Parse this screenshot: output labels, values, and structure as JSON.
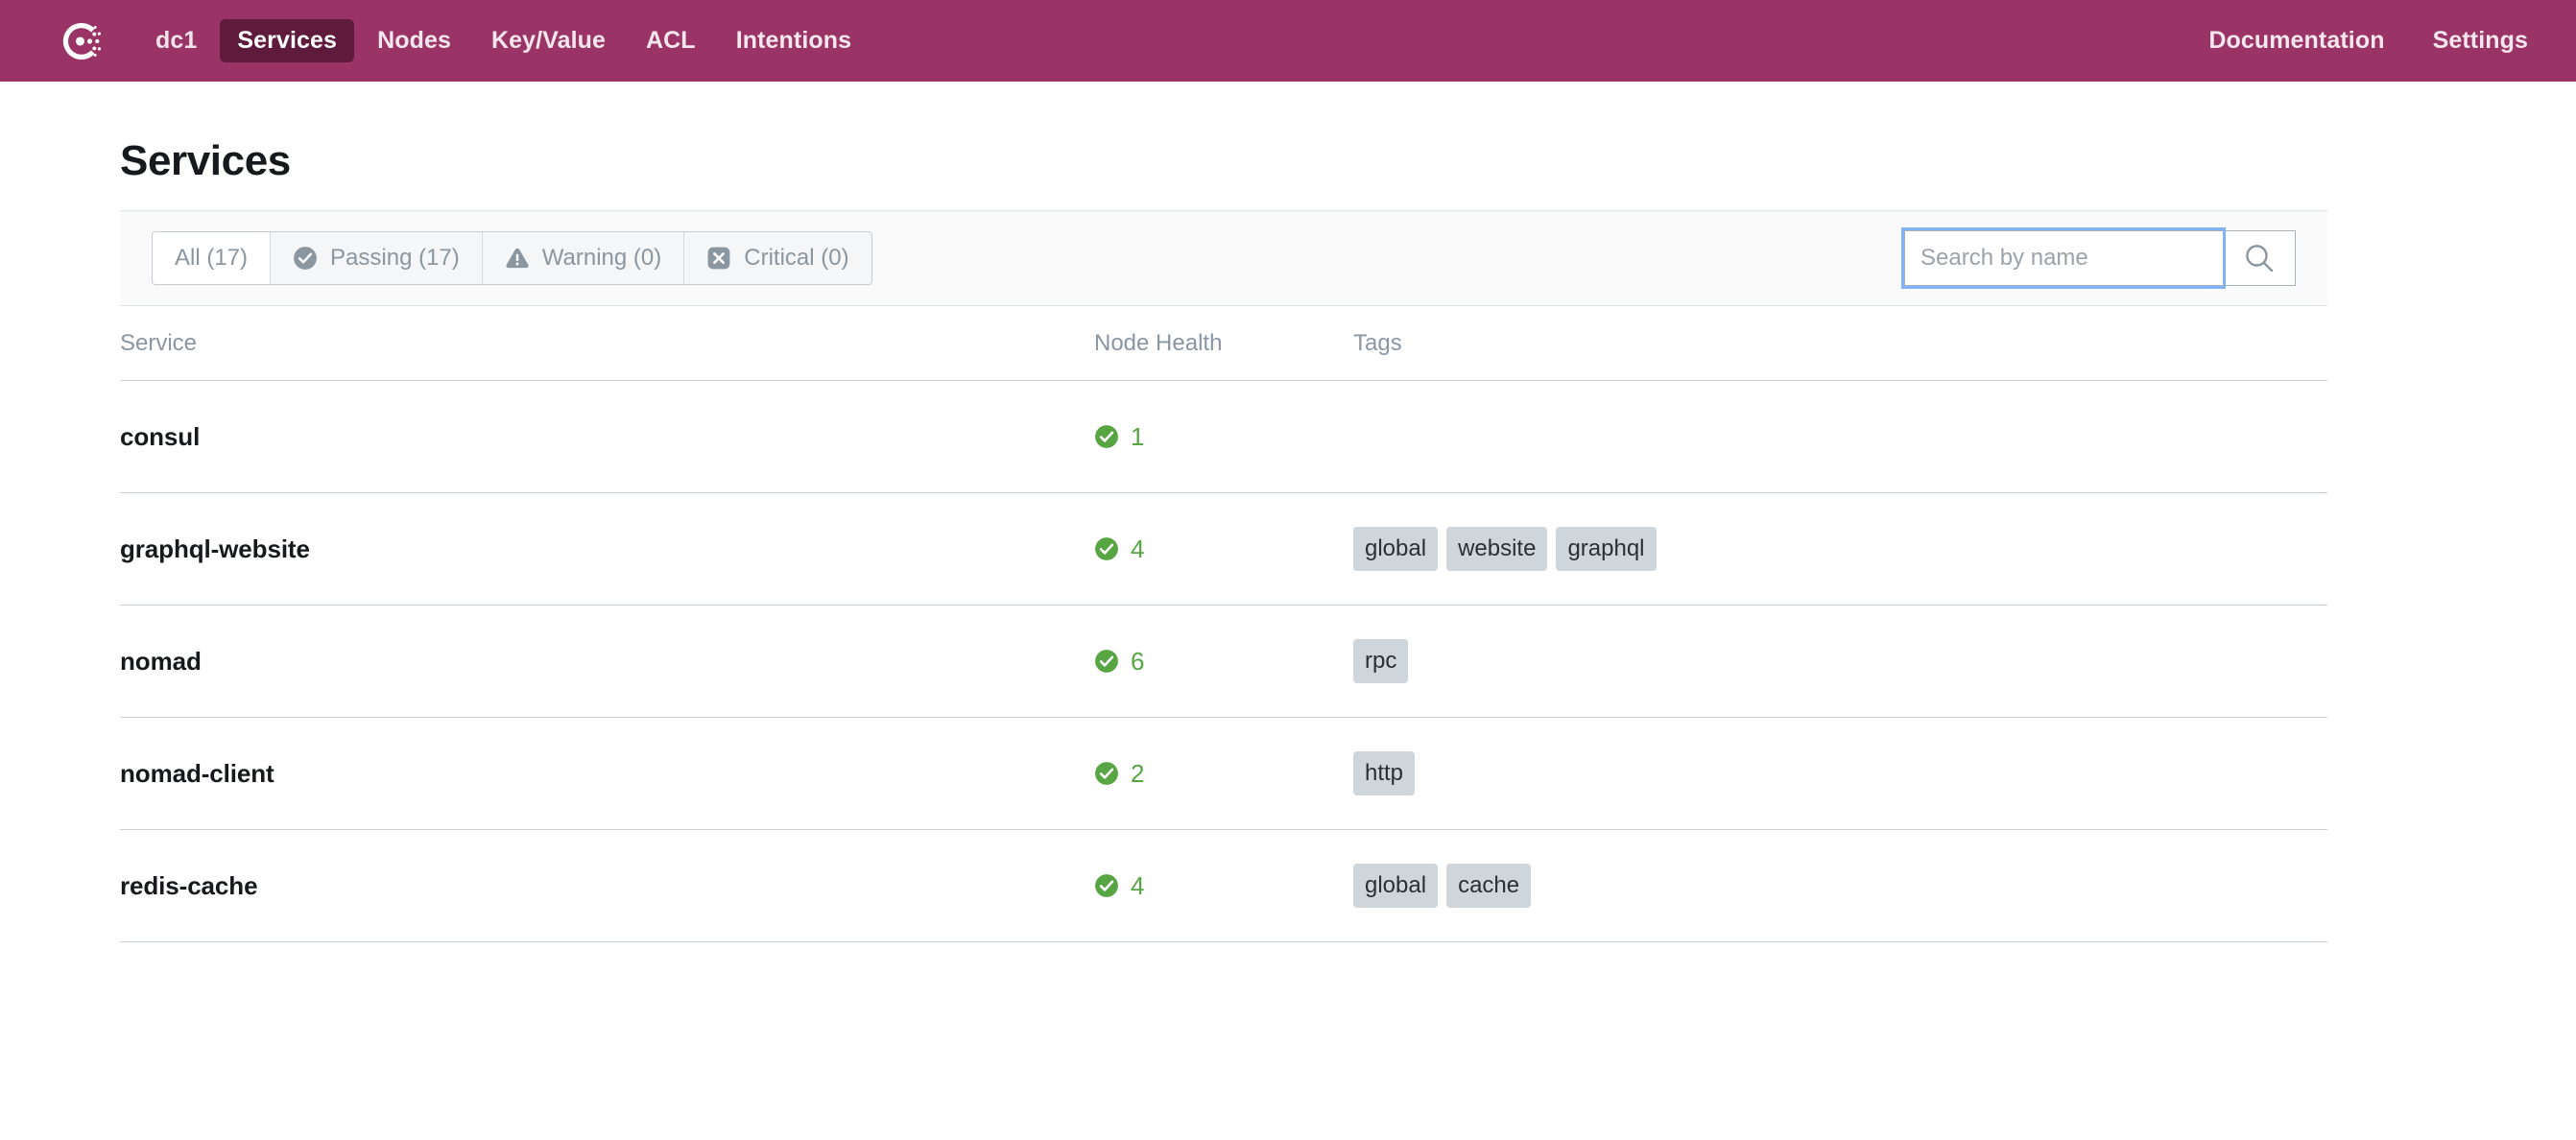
{
  "nav": {
    "logo_icon": "consul-logo-icon",
    "datacenter": "dc1",
    "items": [
      {
        "label": "Services",
        "active": true
      },
      {
        "label": "Nodes",
        "active": false
      },
      {
        "label": "Key/Value",
        "active": false
      },
      {
        "label": "ACL",
        "active": false
      },
      {
        "label": "Intentions",
        "active": false
      }
    ],
    "right_items": [
      {
        "label": "Documentation"
      },
      {
        "label": "Settings"
      }
    ],
    "background_color": "#9A3466",
    "active_pill_color": "#5E1B3C"
  },
  "page": {
    "title": "Services"
  },
  "filters": {
    "tabs": [
      {
        "label": "All (17)",
        "icon": "none",
        "active": true
      },
      {
        "label": "Passing (17)",
        "icon": "check-circle-icon",
        "active": false
      },
      {
        "label": "Warning (0)",
        "icon": "warning-triangle-icon",
        "active": false
      },
      {
        "label": "Critical (0)",
        "icon": "x-square-icon",
        "active": false
      }
    ]
  },
  "search": {
    "placeholder": "Search by name",
    "value": "",
    "button_icon": "search-icon",
    "focused": true,
    "focus_ring_color": "#7FB2F6"
  },
  "table": {
    "columns": [
      "Service",
      "Node Health",
      "Tags"
    ],
    "rows": [
      {
        "service": "consul",
        "health_count": "1",
        "health_status": "passing",
        "tags": []
      },
      {
        "service": "graphql-website",
        "health_count": "4",
        "health_status": "passing",
        "tags": [
          "global",
          "website",
          "graphql"
        ]
      },
      {
        "service": "nomad",
        "health_count": "6",
        "health_status": "passing",
        "tags": [
          "rpc"
        ]
      },
      {
        "service": "nomad-client",
        "health_count": "2",
        "health_status": "passing",
        "tags": [
          "http"
        ]
      },
      {
        "service": "redis-cache",
        "health_count": "4",
        "health_status": "passing",
        "tags": [
          "global",
          "cache"
        ]
      }
    ],
    "passing_color": "#58A544",
    "tag_background": "#CED5DB"
  }
}
